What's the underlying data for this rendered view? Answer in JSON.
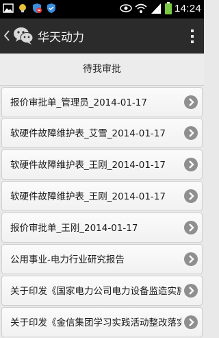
{
  "status_bar": {
    "time": "14:24",
    "left_icons": [
      "image-icon",
      "bulb-icon",
      "shield-block-icon",
      "shield-icon"
    ],
    "right_icons": [
      "eye-icon",
      "wifi-icon",
      "signal-icon",
      "battery-icon"
    ]
  },
  "action_bar": {
    "title": "华天动力",
    "logo": "wechat-icon"
  },
  "section": {
    "title": "待我审批"
  },
  "items": [
    {
      "label": "报价审批单_管理员_2014-01-17"
    },
    {
      "label": "软硬件故障维护表_艾雪_2014-01-17"
    },
    {
      "label": "软硬件故障维护表_王刚_2014-01-17"
    },
    {
      "label": "软硬件故障维护表_王刚_2014-01-17"
    },
    {
      "label": "报价审批单_王刚_2014-01-17"
    },
    {
      "label": "公用事业-电力行业研究报告"
    },
    {
      "label": "关于印发《国家电力公司电力设备监造实施..."
    },
    {
      "label": "关于印发《金信集团学习实践活动整改落实..."
    }
  ]
}
